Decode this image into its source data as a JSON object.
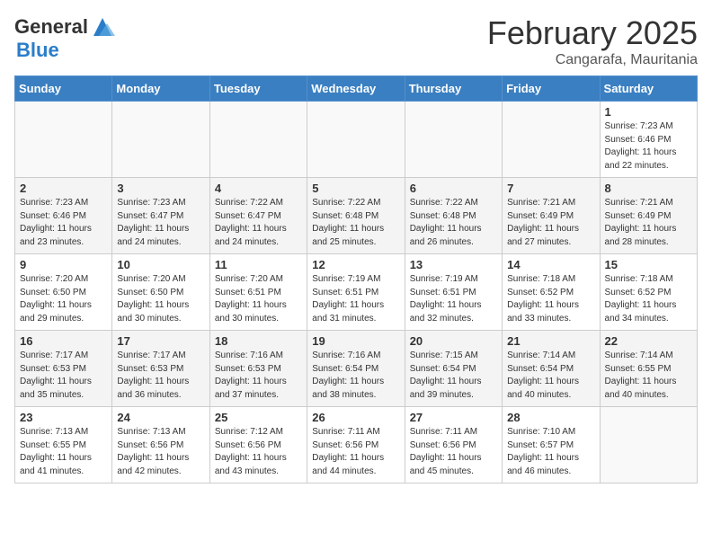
{
  "header": {
    "logo_general": "General",
    "logo_blue": "Blue",
    "month_title": "February 2025",
    "location": "Cangarafa, Mauritania"
  },
  "weekdays": [
    "Sunday",
    "Monday",
    "Tuesday",
    "Wednesday",
    "Thursday",
    "Friday",
    "Saturday"
  ],
  "weeks": [
    [
      {
        "day": "",
        "info": ""
      },
      {
        "day": "",
        "info": ""
      },
      {
        "day": "",
        "info": ""
      },
      {
        "day": "",
        "info": ""
      },
      {
        "day": "",
        "info": ""
      },
      {
        "day": "",
        "info": ""
      },
      {
        "day": "1",
        "info": "Sunrise: 7:23 AM\nSunset: 6:46 PM\nDaylight: 11 hours\nand 22 minutes."
      }
    ],
    [
      {
        "day": "2",
        "info": "Sunrise: 7:23 AM\nSunset: 6:46 PM\nDaylight: 11 hours\nand 23 minutes."
      },
      {
        "day": "3",
        "info": "Sunrise: 7:23 AM\nSunset: 6:47 PM\nDaylight: 11 hours\nand 24 minutes."
      },
      {
        "day": "4",
        "info": "Sunrise: 7:22 AM\nSunset: 6:47 PM\nDaylight: 11 hours\nand 24 minutes."
      },
      {
        "day": "5",
        "info": "Sunrise: 7:22 AM\nSunset: 6:48 PM\nDaylight: 11 hours\nand 25 minutes."
      },
      {
        "day": "6",
        "info": "Sunrise: 7:22 AM\nSunset: 6:48 PM\nDaylight: 11 hours\nand 26 minutes."
      },
      {
        "day": "7",
        "info": "Sunrise: 7:21 AM\nSunset: 6:49 PM\nDaylight: 11 hours\nand 27 minutes."
      },
      {
        "day": "8",
        "info": "Sunrise: 7:21 AM\nSunset: 6:49 PM\nDaylight: 11 hours\nand 28 minutes."
      }
    ],
    [
      {
        "day": "9",
        "info": "Sunrise: 7:20 AM\nSunset: 6:50 PM\nDaylight: 11 hours\nand 29 minutes."
      },
      {
        "day": "10",
        "info": "Sunrise: 7:20 AM\nSunset: 6:50 PM\nDaylight: 11 hours\nand 30 minutes."
      },
      {
        "day": "11",
        "info": "Sunrise: 7:20 AM\nSunset: 6:51 PM\nDaylight: 11 hours\nand 30 minutes."
      },
      {
        "day": "12",
        "info": "Sunrise: 7:19 AM\nSunset: 6:51 PM\nDaylight: 11 hours\nand 31 minutes."
      },
      {
        "day": "13",
        "info": "Sunrise: 7:19 AM\nSunset: 6:51 PM\nDaylight: 11 hours\nand 32 minutes."
      },
      {
        "day": "14",
        "info": "Sunrise: 7:18 AM\nSunset: 6:52 PM\nDaylight: 11 hours\nand 33 minutes."
      },
      {
        "day": "15",
        "info": "Sunrise: 7:18 AM\nSunset: 6:52 PM\nDaylight: 11 hours\nand 34 minutes."
      }
    ],
    [
      {
        "day": "16",
        "info": "Sunrise: 7:17 AM\nSunset: 6:53 PM\nDaylight: 11 hours\nand 35 minutes."
      },
      {
        "day": "17",
        "info": "Sunrise: 7:17 AM\nSunset: 6:53 PM\nDaylight: 11 hours\nand 36 minutes."
      },
      {
        "day": "18",
        "info": "Sunrise: 7:16 AM\nSunset: 6:53 PM\nDaylight: 11 hours\nand 37 minutes."
      },
      {
        "day": "19",
        "info": "Sunrise: 7:16 AM\nSunset: 6:54 PM\nDaylight: 11 hours\nand 38 minutes."
      },
      {
        "day": "20",
        "info": "Sunrise: 7:15 AM\nSunset: 6:54 PM\nDaylight: 11 hours\nand 39 minutes."
      },
      {
        "day": "21",
        "info": "Sunrise: 7:14 AM\nSunset: 6:54 PM\nDaylight: 11 hours\nand 40 minutes."
      },
      {
        "day": "22",
        "info": "Sunrise: 7:14 AM\nSunset: 6:55 PM\nDaylight: 11 hours\nand 40 minutes."
      }
    ],
    [
      {
        "day": "23",
        "info": "Sunrise: 7:13 AM\nSunset: 6:55 PM\nDaylight: 11 hours\nand 41 minutes."
      },
      {
        "day": "24",
        "info": "Sunrise: 7:13 AM\nSunset: 6:56 PM\nDaylight: 11 hours\nand 42 minutes."
      },
      {
        "day": "25",
        "info": "Sunrise: 7:12 AM\nSunset: 6:56 PM\nDaylight: 11 hours\nand 43 minutes."
      },
      {
        "day": "26",
        "info": "Sunrise: 7:11 AM\nSunset: 6:56 PM\nDaylight: 11 hours\nand 44 minutes."
      },
      {
        "day": "27",
        "info": "Sunrise: 7:11 AM\nSunset: 6:56 PM\nDaylight: 11 hours\nand 45 minutes."
      },
      {
        "day": "28",
        "info": "Sunrise: 7:10 AM\nSunset: 6:57 PM\nDaylight: 11 hours\nand 46 minutes."
      },
      {
        "day": "",
        "info": ""
      }
    ]
  ]
}
